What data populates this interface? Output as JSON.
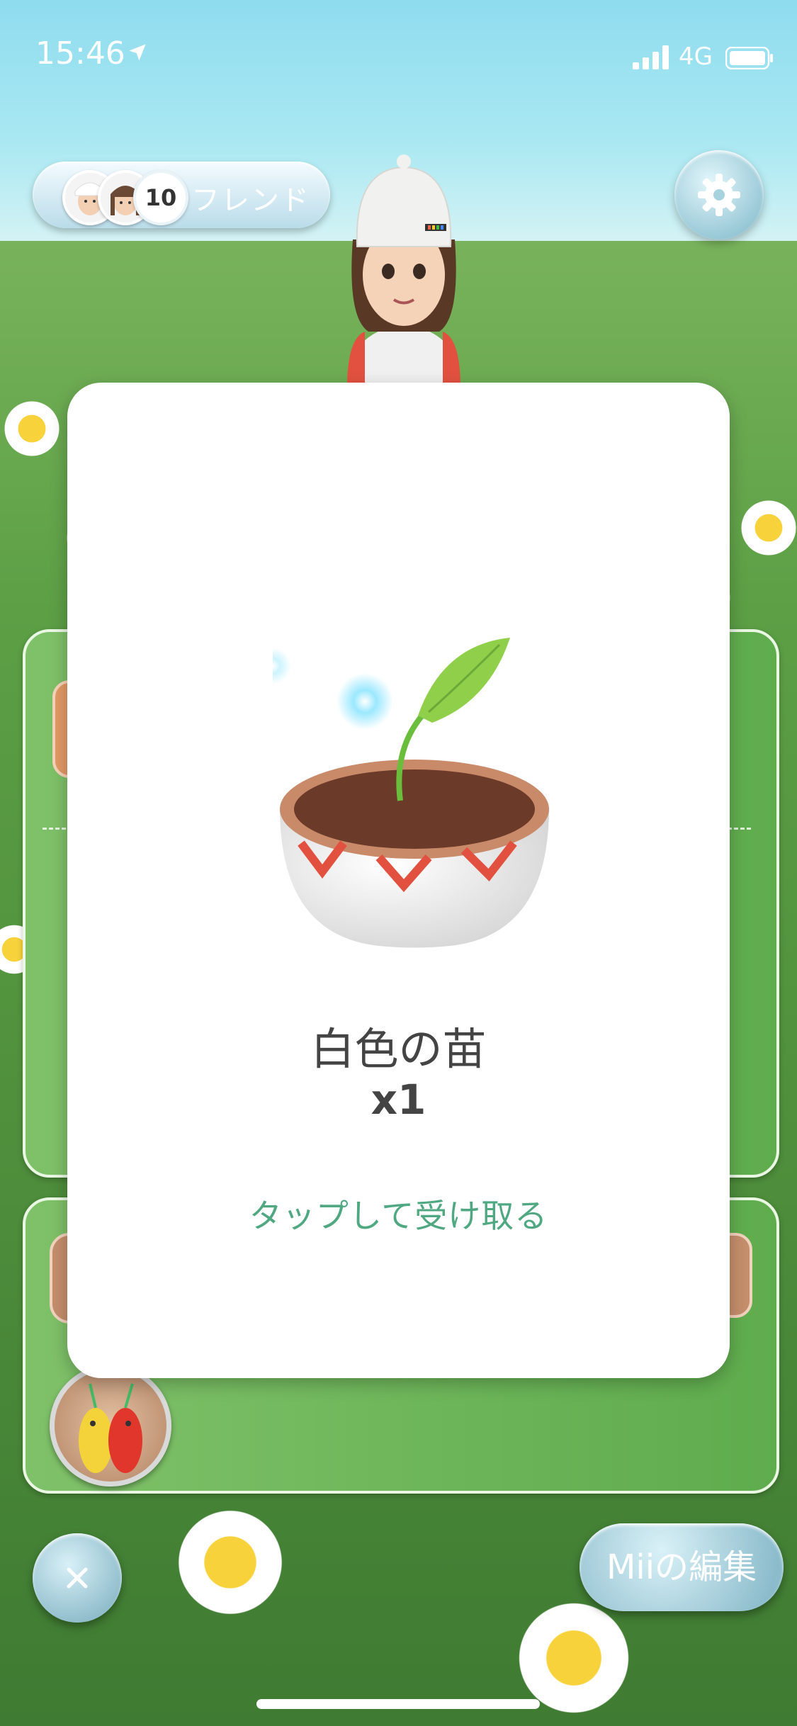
{
  "status_bar": {
    "time": "15:46",
    "network": "4G",
    "icons": [
      "location-arrow-icon",
      "signal-bars-icon",
      "battery-icon"
    ]
  },
  "friends": {
    "count": "10",
    "label": "フレンド",
    "avatars": [
      "friend-avatar",
      "friend-avatar"
    ]
  },
  "settings": {
    "icon": "gear-icon"
  },
  "modal": {
    "item_image": "white-seedling-pot",
    "item_name": "白色の苗",
    "quantity": "x1",
    "tap_hint": "タップして受け取る"
  },
  "bottom": {
    "close_icon": "close-icon",
    "edit_mii_label": "Miiの編集"
  },
  "colors": {
    "sky": "#a9e8f2",
    "grass": "#5c9f45",
    "tap_hint": "#4fa882",
    "button_teal": "#8cbccc",
    "card_green": "#6bb557"
  }
}
